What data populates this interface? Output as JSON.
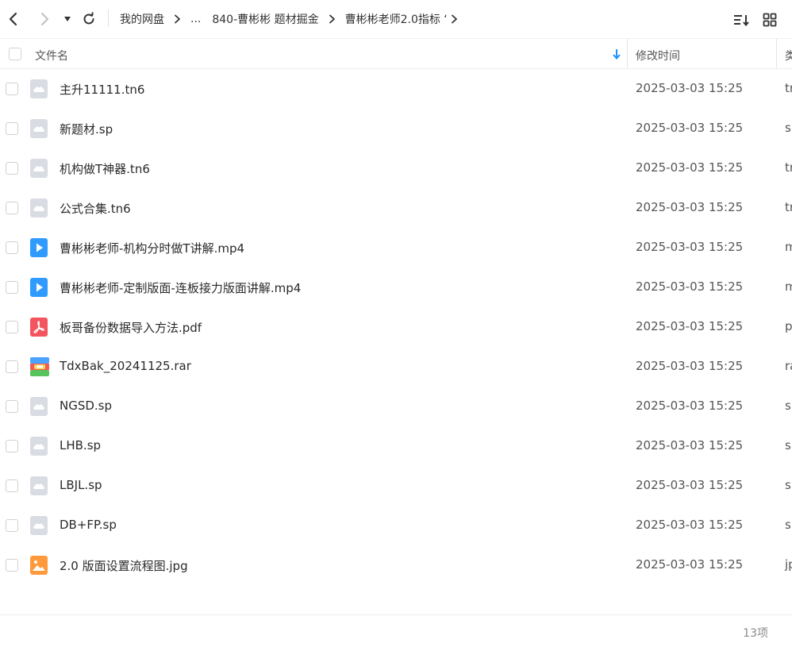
{
  "breadcrumb": {
    "items": [
      "我的网盘",
      "...",
      "840-曹彬彬 题材掘金",
      "曹彬彬老师2.0指标 ‘"
    ]
  },
  "header": {
    "name_label": "文件名",
    "time_label": "修改时间",
    "type_label": "类"
  },
  "files": [
    {
      "name": "主升11111.tn6",
      "time": "2025-03-03 15:25",
      "type": "tr",
      "icon": "generic-file-icon"
    },
    {
      "name": "新题材.sp",
      "time": "2025-03-03 15:25",
      "type": "sp",
      "icon": "generic-file-icon"
    },
    {
      "name": "机构做T神器.tn6",
      "time": "2025-03-03 15:25",
      "type": "tr",
      "icon": "generic-file-icon"
    },
    {
      "name": "公式合集.tn6",
      "time": "2025-03-03 15:25",
      "type": "tr",
      "icon": "generic-file-icon"
    },
    {
      "name": "曹彬彬老师-机构分时做T讲解.mp4",
      "time": "2025-03-03 15:25",
      "type": "m",
      "icon": "video-file-icon"
    },
    {
      "name": "曹彬彬老师-定制版面-连板接力版面讲解.mp4",
      "time": "2025-03-03 15:25",
      "type": "m",
      "icon": "video-file-icon"
    },
    {
      "name": "板哥备份数据导入方法.pdf",
      "time": "2025-03-03 15:25",
      "type": "p",
      "icon": "pdf-file-icon"
    },
    {
      "name": "TdxBak_20241125.rar",
      "time": "2025-03-03 15:25",
      "type": "ra",
      "icon": "archive-file-icon"
    },
    {
      "name": "NGSD.sp",
      "time": "2025-03-03 15:25",
      "type": "sp",
      "icon": "generic-file-icon"
    },
    {
      "name": "LHB.sp",
      "time": "2025-03-03 15:25",
      "type": "sp",
      "icon": "generic-file-icon"
    },
    {
      "name": "LBJL.sp",
      "time": "2025-03-03 15:25",
      "type": "sp",
      "icon": "generic-file-icon"
    },
    {
      "name": "DB+FP.sp",
      "time": "2025-03-03 15:25",
      "type": "sp",
      "icon": "generic-file-icon"
    },
    {
      "name": "2.0 版面设置流程图.jpg",
      "time": "2025-03-03 15:25",
      "type": "jp",
      "icon": "image-file-icon"
    }
  ],
  "footer": {
    "count": "13项"
  },
  "colors": {
    "video": "#2f9bff",
    "pdf": "#f4545d",
    "image": "#ff9a3c",
    "generic": "#d9dde3"
  }
}
